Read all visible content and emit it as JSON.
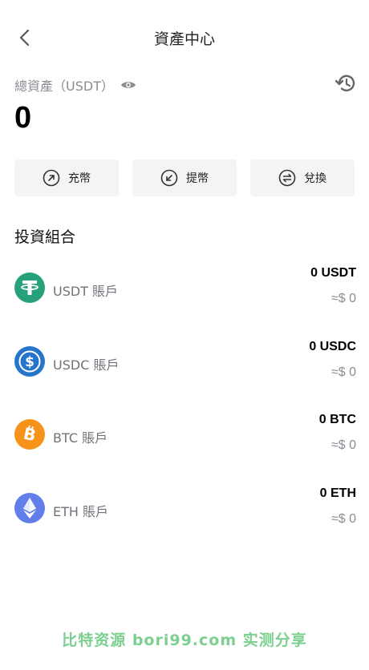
{
  "header": {
    "title": "資產中心"
  },
  "summary": {
    "label": "總資產（USDT）",
    "total": "0"
  },
  "actions": [
    {
      "label": "充幣",
      "icon": "arrow-up-right-circle-icon"
    },
    {
      "label": "提幣",
      "icon": "arrow-down-left-circle-icon"
    },
    {
      "label": "兌換",
      "icon": "swap-circle-icon"
    }
  ],
  "portfolio": {
    "title": "投資組合",
    "accounts": [
      {
        "name": "USDT 賬戶",
        "amount": "0 USDT",
        "approx": "≈$ 0",
        "color": "#26a17b",
        "icon": "usdt-icon"
      },
      {
        "name": "USDC 賬戶",
        "amount": "0 USDC",
        "approx": "≈$ 0",
        "color": "#2775ca",
        "icon": "usdc-icon"
      },
      {
        "name": "BTC 賬戶",
        "amount": "0 BTC",
        "approx": "≈$ 0",
        "color": "#f7931a",
        "icon": "btc-icon"
      },
      {
        "name": "ETH 賬戶",
        "amount": "0 ETH",
        "approx": "≈$ 0",
        "color": "#627eea",
        "icon": "eth-icon"
      }
    ]
  },
  "watermark": "比特资源 bori99.com 实测分享"
}
